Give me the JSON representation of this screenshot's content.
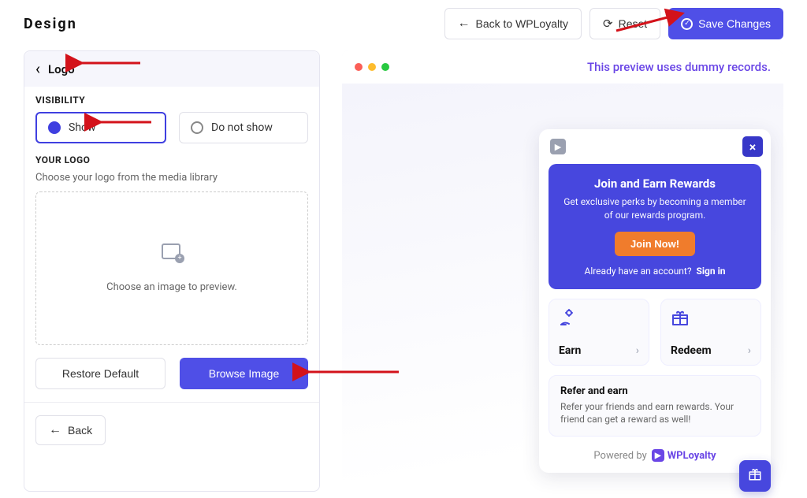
{
  "header": {
    "page_title": "Design",
    "back_label": "Back to WPLoyalty",
    "reset_label": "Reset",
    "save_label": "Save Changes"
  },
  "panel": {
    "head_title": "Logo",
    "visibility_label": "VISIBILITY",
    "option_show": "Show",
    "option_hide": "Do not show",
    "logo_section_label": "YOUR LOGO",
    "logo_section_desc": "Choose your logo from the media library",
    "dropzone_text": "Choose an image to preview.",
    "restore_label": "Restore Default",
    "browse_label": "Browse Image",
    "back_label": "Back"
  },
  "preview": {
    "note": "This preview uses dummy records.",
    "join_title": "Join and Earn Rewards",
    "join_desc": "Get exclusive perks by becoming a member of our rewards program.",
    "join_btn": "Join Now!",
    "signin_prompt": "Already have an account?",
    "signin_link": "Sign in",
    "earn_label": "Earn",
    "redeem_label": "Redeem",
    "refer_title": "Refer and earn",
    "refer_desc": "Refer your friends and earn rewards. Your friend can get a reward as well!",
    "powered_prefix": "Powered by",
    "powered_brand": "WPLoyalty"
  }
}
